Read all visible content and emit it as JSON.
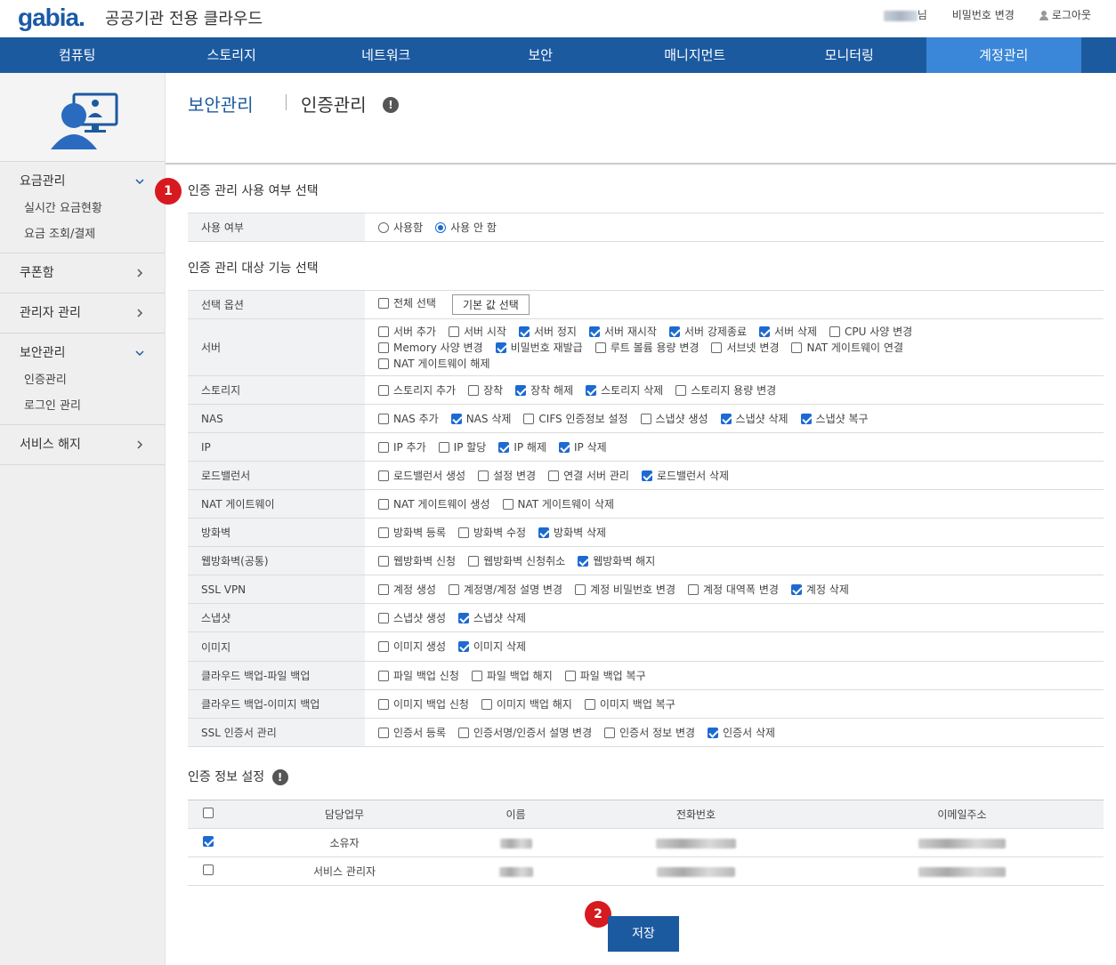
{
  "header": {
    "logo": "gabia.",
    "logo_sub": "공공기관 전용 클라우드",
    "user_suffix": "님",
    "change_password": "비밀번호 변경",
    "logout": "로그아웃"
  },
  "nav": [
    "컴퓨팅",
    "스토리지",
    "네트워크",
    "보안",
    "매니지먼트",
    "모니터링",
    "계정관리"
  ],
  "nav_active_index": 6,
  "sidebar": {
    "groups": [
      {
        "label": "요금관리",
        "expanded": true,
        "items": [
          "실시간 요금현황",
          "요금 조회/결제"
        ]
      },
      {
        "label": "쿠폰함",
        "expanded": false,
        "items": []
      },
      {
        "label": "관리자 관리",
        "expanded": false,
        "items": []
      },
      {
        "label": "보안관리",
        "expanded": true,
        "items": [
          "인증관리",
          "로그인 관리"
        ]
      },
      {
        "label": "서비스 해지",
        "expanded": false,
        "items": []
      }
    ]
  },
  "breadcrumb": {
    "parent": "보안관리",
    "current": "인증관리"
  },
  "section1": {
    "badge": "1",
    "title": "인증 관리 사용 여부 선택",
    "label": "사용 여부",
    "options": [
      {
        "label": "사용함",
        "checked": false
      },
      {
        "label": "사용 안 함",
        "checked": true
      }
    ]
  },
  "section2": {
    "title": "인증 관리 대상 기능 선택",
    "select_option_label": "선택 옵션",
    "select_all": "전체 선택",
    "default_button": "기본 값 선택",
    "rows": [
      {
        "label": "서버",
        "items": [
          [
            "서버 추가",
            false
          ],
          [
            "서버 시작",
            false
          ],
          [
            "서버 정지",
            true
          ],
          [
            "서버 재시작",
            true
          ],
          [
            "서버 강제종료",
            true
          ],
          [
            "서버 삭제",
            true
          ],
          [
            "CPU 사양 변경",
            false
          ],
          [
            "Memory 사양 변경",
            false
          ],
          [
            "비밀번호 재발급",
            true
          ],
          [
            "루트 볼륨 용량 변경",
            false
          ],
          [
            "서브넷 변경",
            false
          ],
          [
            "NAT 게이트웨이 연결",
            false
          ],
          [
            "NAT 게이트웨이 해제",
            false
          ]
        ]
      },
      {
        "label": "스토리지",
        "items": [
          [
            "스토리지 추가",
            false
          ],
          [
            "장착",
            false
          ],
          [
            "장착 해제",
            true
          ],
          [
            "스토리지 삭제",
            true
          ],
          [
            "스토리지 용량 변경",
            false
          ]
        ]
      },
      {
        "label": "NAS",
        "items": [
          [
            "NAS 추가",
            false
          ],
          [
            "NAS 삭제",
            true
          ],
          [
            "CIFS 인증정보 설정",
            false
          ],
          [
            "스냅샷 생성",
            false
          ],
          [
            "스냅샷 삭제",
            true
          ],
          [
            "스냅샷 복구",
            true
          ]
        ]
      },
      {
        "label": "IP",
        "items": [
          [
            "IP 추가",
            false
          ],
          [
            "IP 할당",
            false
          ],
          [
            "IP 해제",
            true
          ],
          [
            "IP 삭제",
            true
          ]
        ]
      },
      {
        "label": "로드밸런서",
        "items": [
          [
            "로드밸런서 생성",
            false
          ],
          [
            "설정 변경",
            false
          ],
          [
            "연결 서버 관리",
            false
          ],
          [
            "로드밸런서 삭제",
            true
          ]
        ]
      },
      {
        "label": "NAT 게이트웨이",
        "items": [
          [
            "NAT 게이트웨이 생성",
            false
          ],
          [
            "NAT 게이트웨이 삭제",
            false
          ]
        ]
      },
      {
        "label": "방화벽",
        "items": [
          [
            "방화벽 등록",
            false
          ],
          [
            "방화벽 수정",
            false
          ],
          [
            "방화벽 삭제",
            true
          ]
        ]
      },
      {
        "label": "웹방화벽(공통)",
        "items": [
          [
            "웹방화벽 신청",
            false
          ],
          [
            "웹방화벽 신청취소",
            false
          ],
          [
            "웹방화벽 해지",
            true
          ]
        ]
      },
      {
        "label": "SSL VPN",
        "items": [
          [
            "계정 생성",
            false
          ],
          [
            "계정명/계정 설명 변경",
            false
          ],
          [
            "계정 비밀번호 변경",
            false
          ],
          [
            "계정 대역폭 변경",
            false
          ],
          [
            "계정 삭제",
            true
          ]
        ]
      },
      {
        "label": "스냅샷",
        "items": [
          [
            "스냅샷 생성",
            false
          ],
          [
            "스냅샷 삭제",
            true
          ]
        ]
      },
      {
        "label": "이미지",
        "items": [
          [
            "이미지 생성",
            false
          ],
          [
            "이미지 삭제",
            true
          ]
        ]
      },
      {
        "label": "클라우드 백업-파일 백업",
        "items": [
          [
            "파일 백업 신청",
            false
          ],
          [
            "파일 백업 해지",
            false
          ],
          [
            "파일 백업 복구",
            false
          ]
        ]
      },
      {
        "label": "클라우드 백업-이미지 백업",
        "items": [
          [
            "이미지 백업 신청",
            false
          ],
          [
            "이미지 백업 해지",
            false
          ],
          [
            "이미지 백업 복구",
            false
          ]
        ]
      },
      {
        "label": "SSL 인증서 관리",
        "items": [
          [
            "인증서 등록",
            false
          ],
          [
            "인증서명/인증서 설명 변경",
            false
          ],
          [
            "인증서 정보 변경",
            false
          ],
          [
            "인증서 삭제",
            true
          ]
        ]
      }
    ]
  },
  "section3": {
    "title": "인증 정보 설정",
    "columns": [
      "담당업무",
      "이름",
      "전화번호",
      "이메일주소"
    ],
    "rows": [
      {
        "checked": true,
        "role": "소유자"
      },
      {
        "checked": false,
        "role": "서비스 관리자"
      }
    ]
  },
  "save": {
    "badge": "2",
    "label": "저장"
  }
}
